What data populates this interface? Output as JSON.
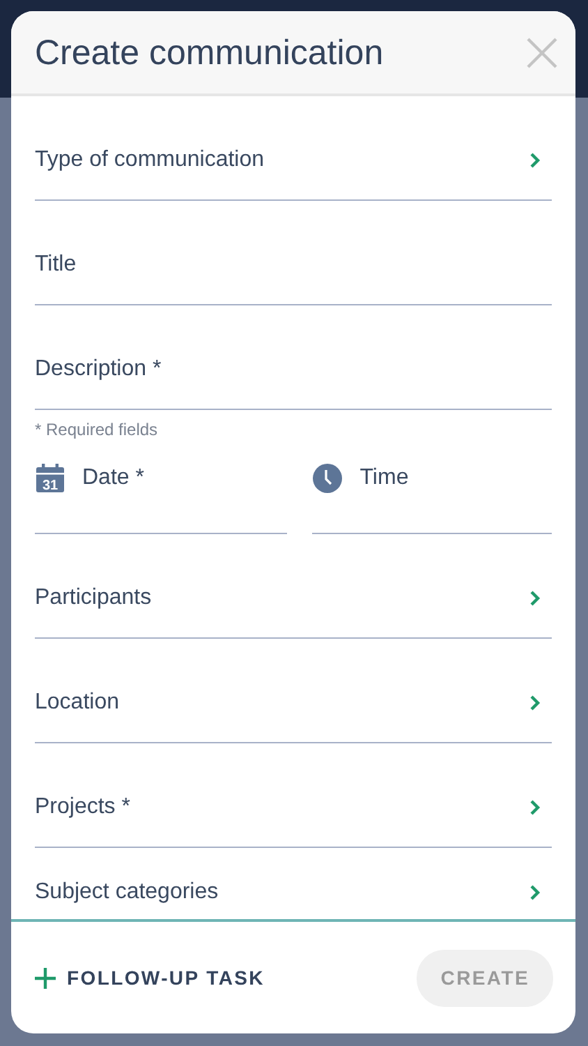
{
  "dialog": {
    "title": "Create communication"
  },
  "fields": [
    {
      "label": "Type of communication",
      "kind": "select"
    },
    {
      "label": "Title",
      "kind": "text"
    },
    {
      "label": "Description *",
      "kind": "text"
    }
  ],
  "required_note": "* Required fields",
  "datetime": [
    {
      "label": "Date *",
      "kind": "date",
      "day": "31"
    },
    {
      "label": "Time",
      "kind": "time"
    }
  ],
  "more_fields": [
    {
      "label": "Participants",
      "kind": "select"
    },
    {
      "label": "Location",
      "kind": "select"
    },
    {
      "label": "Projects *",
      "kind": "select"
    },
    {
      "label": "Subject categories",
      "kind": "select"
    }
  ],
  "footer": {
    "follow_up": "FOLLOW-UP TASK",
    "create": {
      "label": "CREATE",
      "disabled": true
    }
  }
}
